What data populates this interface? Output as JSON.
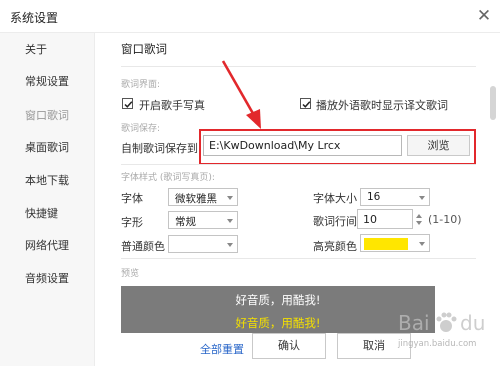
{
  "window": {
    "title": "系统设置",
    "close_label": "✕"
  },
  "sidebar": {
    "items": [
      {
        "label": "关于"
      },
      {
        "label": "常规设置"
      },
      {
        "label": "窗口歌词"
      },
      {
        "label": "桌面歌词"
      },
      {
        "label": "本地下载"
      },
      {
        "label": "快捷键"
      },
      {
        "label": "网络代理"
      },
      {
        "label": "音频设置"
      }
    ]
  },
  "main": {
    "section_title": "窗口歌词",
    "lyric_ui": {
      "heading": "歌词界面:",
      "show_singer_photo": {
        "label": "开启歌手写真",
        "checked": true
      },
      "show_translation": {
        "label": "播放外语歌时显示译文歌词",
        "checked": true
      }
    },
    "lyric_save": {
      "heading": "歌词保存:",
      "label": "自制歌词保存到:",
      "path": "E:\\KwDownload\\My Lrcx",
      "browse_label": "浏览"
    },
    "font_style": {
      "heading": "字体样式 (歌词写真页):",
      "font_label": "字体",
      "font_value": "微软雅黑",
      "size_label": "字体大小",
      "size_value": "16",
      "shape_label": "字形",
      "shape_value": "常规",
      "line_spacing_label": "歌词行间",
      "line_spacing_value": "10",
      "line_spacing_range": "(1-10)",
      "normal_color_label": "普通颜色",
      "normal_color": "#ffffff",
      "highlight_color_label": "高亮颜色",
      "highlight_color": "#ffe600"
    },
    "preview": {
      "heading": "预览",
      "line1": "好音质，用酷我!",
      "line2": "好音质，用酷我!",
      "background": "#7b7b7b",
      "line2_color": "#f4e000"
    }
  },
  "footer": {
    "reset_label": "全部重置",
    "ok_label": "确认",
    "cancel_label": "取消"
  },
  "watermark": {
    "brand": "Bai",
    "brand2": "du",
    "sub": "jingyan.baidu.com"
  },
  "colors": {
    "annotation_red": "#e2282c",
    "link_blue": "#2a67c9"
  }
}
